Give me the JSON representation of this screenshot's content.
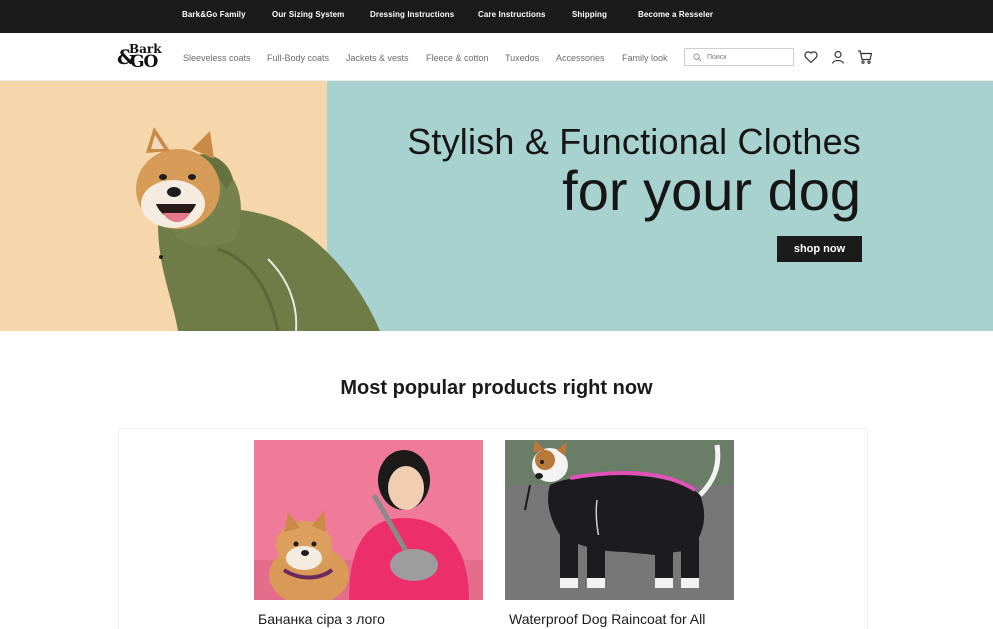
{
  "topbar": {
    "links": [
      "Bark&Go Family",
      "Our Sizing System",
      "Dressing Instructions",
      "Care Instructions",
      "Shipping",
      "Become a Resseler"
    ]
  },
  "header": {
    "logo": {
      "line1": "Bark",
      "amp": "&",
      "line2": "GO"
    },
    "nav": [
      "Sleeveless coats",
      "Full-Body coats",
      "Jackets & vests",
      "Fleece & cotton",
      "Tuxedos",
      "Accessories",
      "Family look"
    ],
    "search": {
      "placeholder": "Поиск",
      "value": ""
    },
    "icons": [
      "search-icon",
      "heart-icon",
      "user-icon",
      "cart-icon"
    ]
  },
  "hero": {
    "title": "Stylish & Functional Clothes",
    "subtitle": "for your dog",
    "cta": "shop now",
    "colors": {
      "left": "#f6d6ab",
      "right": "#a8d2d0"
    }
  },
  "popular": {
    "title": "Most popular products right now",
    "products": [
      {
        "name": "Бананка сіра з лого"
      },
      {
        "name": "Waterproof Dog Raincoat for All"
      }
    ]
  }
}
